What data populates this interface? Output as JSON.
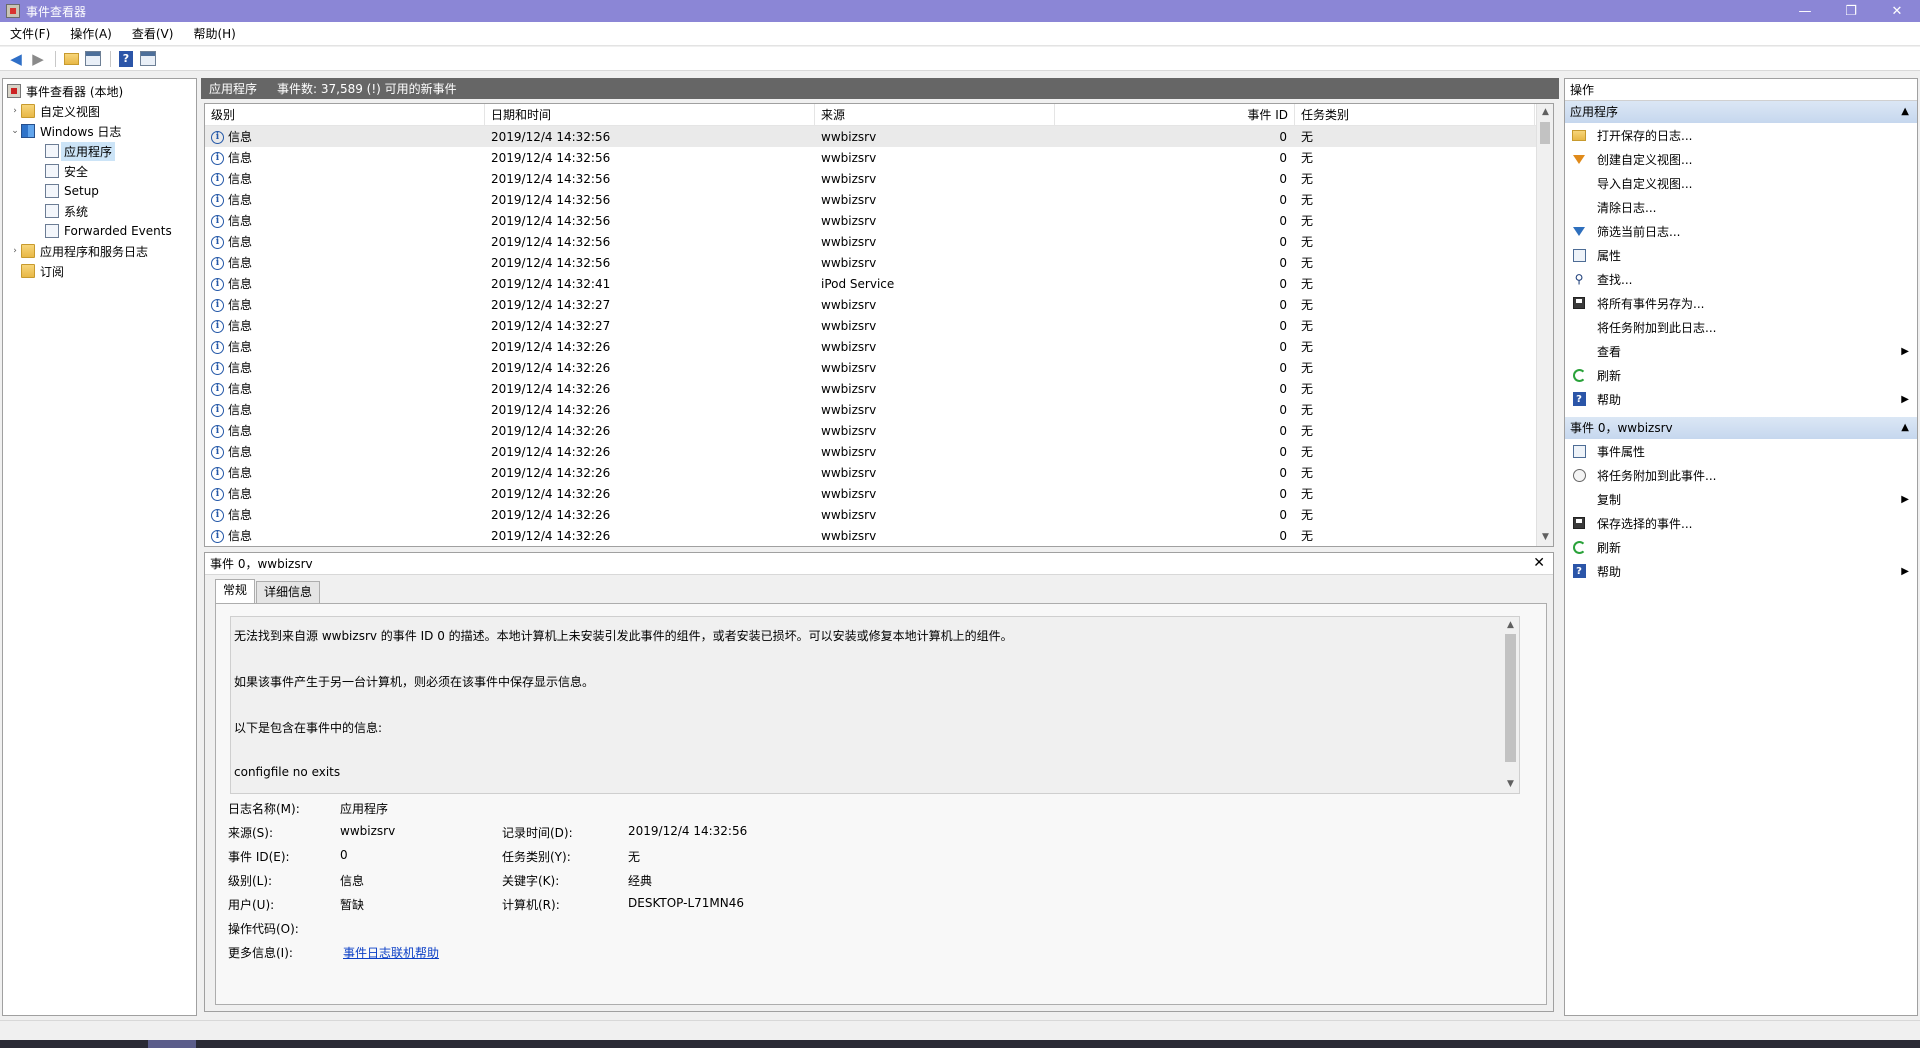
{
  "window": {
    "title": "事件查看器",
    "minimize": "—",
    "restore": "❐",
    "close": "✕"
  },
  "menu": [
    "文件(F)",
    "操作(A)",
    "查看(V)",
    "帮助(H)"
  ],
  "tree": {
    "root": "事件查看器 (本地)",
    "custom_views": "自定义视图",
    "windows_logs": "Windows 日志",
    "application": "应用程序",
    "security": "安全",
    "setup": "Setup",
    "system": "系统",
    "forwarded": "Forwarded Events",
    "app_service_logs": "应用程序和服务日志",
    "subscriptions": "订阅"
  },
  "log_header": {
    "name": "应用程序",
    "count": "事件数: 37,589 (!) 可用的新事件"
  },
  "grid": {
    "columns": {
      "level": "级别",
      "date": "日期和时间",
      "source": "来源",
      "event_id": "事件 ID",
      "task": "任务类别"
    },
    "rows": [
      {
        "level": "信息",
        "date": "2019/12/4 14:32:56",
        "source": "wwbizsrv",
        "id": "0",
        "task": "无"
      },
      {
        "level": "信息",
        "date": "2019/12/4 14:32:56",
        "source": "wwbizsrv",
        "id": "0",
        "task": "无"
      },
      {
        "level": "信息",
        "date": "2019/12/4 14:32:56",
        "source": "wwbizsrv",
        "id": "0",
        "task": "无"
      },
      {
        "level": "信息",
        "date": "2019/12/4 14:32:56",
        "source": "wwbizsrv",
        "id": "0",
        "task": "无"
      },
      {
        "level": "信息",
        "date": "2019/12/4 14:32:56",
        "source": "wwbizsrv",
        "id": "0",
        "task": "无"
      },
      {
        "level": "信息",
        "date": "2019/12/4 14:32:56",
        "source": "wwbizsrv",
        "id": "0",
        "task": "无"
      },
      {
        "level": "信息",
        "date": "2019/12/4 14:32:56",
        "source": "wwbizsrv",
        "id": "0",
        "task": "无"
      },
      {
        "level": "信息",
        "date": "2019/12/4 14:32:41",
        "source": "iPod Service",
        "id": "0",
        "task": "无"
      },
      {
        "level": "信息",
        "date": "2019/12/4 14:32:27",
        "source": "wwbizsrv",
        "id": "0",
        "task": "无"
      },
      {
        "level": "信息",
        "date": "2019/12/4 14:32:27",
        "source": "wwbizsrv",
        "id": "0",
        "task": "无"
      },
      {
        "level": "信息",
        "date": "2019/12/4 14:32:26",
        "source": "wwbizsrv",
        "id": "0",
        "task": "无"
      },
      {
        "level": "信息",
        "date": "2019/12/4 14:32:26",
        "source": "wwbizsrv",
        "id": "0",
        "task": "无"
      },
      {
        "level": "信息",
        "date": "2019/12/4 14:32:26",
        "source": "wwbizsrv",
        "id": "0",
        "task": "无"
      },
      {
        "level": "信息",
        "date": "2019/12/4 14:32:26",
        "source": "wwbizsrv",
        "id": "0",
        "task": "无"
      },
      {
        "level": "信息",
        "date": "2019/12/4 14:32:26",
        "source": "wwbizsrv",
        "id": "0",
        "task": "无"
      },
      {
        "level": "信息",
        "date": "2019/12/4 14:32:26",
        "source": "wwbizsrv",
        "id": "0",
        "task": "无"
      },
      {
        "level": "信息",
        "date": "2019/12/4 14:32:26",
        "source": "wwbizsrv",
        "id": "0",
        "task": "无"
      },
      {
        "level": "信息",
        "date": "2019/12/4 14:32:26",
        "source": "wwbizsrv",
        "id": "0",
        "task": "无"
      },
      {
        "level": "信息",
        "date": "2019/12/4 14:32:26",
        "source": "wwbizsrv",
        "id": "0",
        "task": "无"
      },
      {
        "level": "信息",
        "date": "2019/12/4 14:32:26",
        "source": "wwbizsrv",
        "id": "0",
        "task": "无"
      }
    ]
  },
  "detail": {
    "title": "事件 0，wwbizsrv",
    "tabs": [
      "常规",
      "详细信息"
    ],
    "description": [
      "无法找到来自源 wwbizsrv 的事件 ID 0 的描述。本地计算机上未安装引发此事件的组件，或者安装已损坏。可以安装或修复本地计算机上的组件。",
      "如果该事件产生于另一台计算机，则必须在该事件中保存显示信息。",
      "以下是包含在事件中的信息:",
      "configfile no exits"
    ],
    "fields": {
      "log_name_label": "日志名称(M):",
      "log_name": "应用程序",
      "source_label": "来源(S):",
      "source": "wwbizsrv",
      "logged_label": "记录时间(D):",
      "logged": "2019/12/4 14:32:56",
      "event_id_label": "事件 ID(E):",
      "event_id": "0",
      "task_label": "任务类别(Y):",
      "task": "无",
      "level_label": "级别(L):",
      "level": "信息",
      "keywords_label": "关键字(K):",
      "keywords": "经典",
      "user_label": "用户(U):",
      "user": "暂缺",
      "computer_label": "计算机(R):",
      "computer": "DESKTOP-L71MN46",
      "opcode_label": "操作代码(O):",
      "opcode": "",
      "more_info_label": "更多信息(I):",
      "more_info": "事件日志联机帮助"
    }
  },
  "actions": {
    "title": "操作",
    "section1": "应用程序",
    "items1": [
      "打开保存的日志...",
      "创建自定义视图...",
      "导入自定义视图...",
      "清除日志...",
      "筛选当前日志...",
      "属性",
      "查找...",
      "将所有事件另存为...",
      "将任务附加到此日志...",
      "查看",
      "刷新",
      "帮助"
    ],
    "section2": "事件 0，wwbizsrv",
    "items2": [
      "事件属性",
      "将任务附加到此事件...",
      "复制",
      "保存选择的事件...",
      "刷新",
      "帮助"
    ]
  }
}
